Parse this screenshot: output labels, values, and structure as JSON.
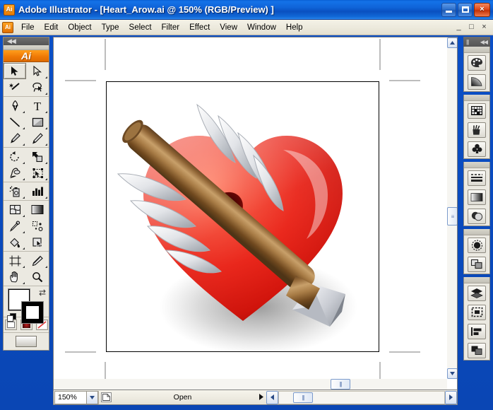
{
  "window": {
    "app_icon_label": "Ai",
    "title": "Adobe Illustrator - [Heart_Arow.ai @ 150% (RGB/Preview) ]",
    "buttons": {
      "minimize": "minimize-button",
      "maximize": "maximize-button",
      "close": "×"
    }
  },
  "menubar": {
    "doc_icon_label": "Ai",
    "items": [
      {
        "label": "File"
      },
      {
        "label": "Edit"
      },
      {
        "label": "Object"
      },
      {
        "label": "Type"
      },
      {
        "label": "Select"
      },
      {
        "label": "Filter"
      },
      {
        "label": "Effect"
      },
      {
        "label": "View"
      },
      {
        "label": "Window"
      },
      {
        "label": "Help"
      }
    ],
    "mdi_buttons": [
      "_",
      "□",
      "×"
    ]
  },
  "toolbar": {
    "collapse_glyph": "◀◀",
    "logo_label": "Ai",
    "tools": [
      "selection-tool",
      "direct-selection-tool",
      "magic-wand-tool",
      "lasso-tool",
      "pen-tool",
      "type-tool",
      "line-segment-tool",
      "rectangle-tool",
      "paintbrush-tool",
      "pencil-tool",
      "rotate-tool",
      "scale-tool",
      "warp-tool",
      "free-transform-tool",
      "symbol-sprayer-tool",
      "column-graph-tool",
      "mesh-tool",
      "gradient-tool",
      "eyedropper-tool",
      "blend-tool",
      "live-paint-bucket-tool",
      "live-paint-selection-tool",
      "crop-area-tool",
      "slice-tool",
      "hand-tool",
      "zoom-tool"
    ],
    "fill_color": "#ffffff",
    "stroke_color": "#000000",
    "swap_glyph": "⇄",
    "mode_buttons": [
      "color-mode",
      "gradient-mode",
      "none-mode"
    ],
    "screen_mode": "screen-mode-button"
  },
  "dock": {
    "collapse_glyph": "◀◀",
    "grip_glyph": "|||",
    "groups": [
      {
        "items": [
          "color-panel-icon",
          "gradient-panel-icon"
        ]
      },
      {
        "items": [
          "swatches-panel-icon",
          "brushes-panel-icon",
          "symbols-panel-icon"
        ]
      },
      {
        "items": [
          "stroke-panel-icon",
          "gradient-fill-panel-icon",
          "transparency-panel-icon"
        ]
      },
      {
        "items": [
          "appearance-panel-icon",
          "graphic-styles-panel-icon"
        ]
      },
      {
        "items": [
          "layers-panel-icon",
          "artboards-panel-icon",
          "align-panel-icon",
          "pathfinder-panel-icon"
        ]
      }
    ]
  },
  "document": {
    "artwork_name": "heart-pierced-by-arrow",
    "colors": {
      "heart_light": "#f4452a",
      "heart_mid": "#e8190d",
      "heart_dark": "#b00d08",
      "heart_hole": "#4a0604",
      "arrow_shaft_light": "#c39a64",
      "arrow_shaft_mid": "#8a5f33",
      "arrow_shaft_dark": "#5d3d1c",
      "feather_light": "#ffffff",
      "feather_mid": "#d8dade",
      "feather_dark": "#8f949c",
      "arrowhead_light": "#e9eaee",
      "arrowhead_dark": "#9fa4ad",
      "artboard_border": "#000000",
      "crop_mark": "#bdbdbd"
    }
  },
  "scrollbars": {
    "vertical": {
      "up_glyph": "▲",
      "down_glyph": "▼",
      "thumb": "scroll-thumb-vertical"
    },
    "horizontal": {
      "left_glyph": "◀",
      "right_glyph": "▶",
      "thumb": "scroll-thumb-horizontal"
    }
  },
  "statusbar": {
    "zoom_value": "150%",
    "zoom_dropdown_glyph": "▼",
    "status_icon": "document-status-icon",
    "status_text": "Open",
    "status_arrow_glyph": "▶"
  }
}
